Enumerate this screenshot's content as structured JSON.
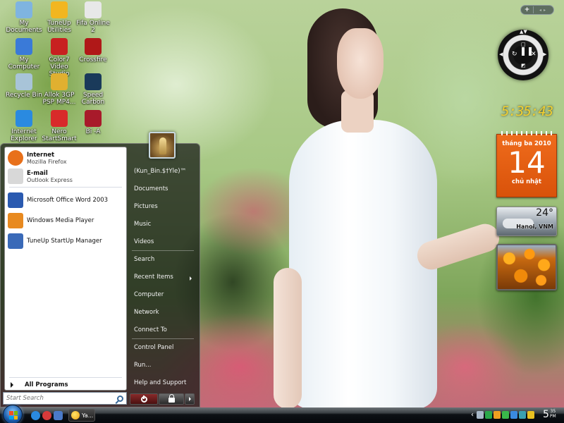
{
  "desktop": {
    "icons": [
      {
        "label_1": "My",
        "label_2": "Documents",
        "icon": "documents-icon",
        "color": "#7fb4e0"
      },
      {
        "label_1": "TuneUp",
        "label_2": "Utilities",
        "icon": "tuneup-icon",
        "color": "#f2b620"
      },
      {
        "label_1": "Fifa Online 2",
        "label_2": "",
        "icon": "fifa-icon",
        "color": "#e8e8e8"
      },
      {
        "label_1": "My",
        "label_2": "Computer",
        "icon": "computer-icon",
        "color": "#3a7ad8"
      },
      {
        "label_1": "Color7 Video",
        "label_2": "Studio",
        "icon": "video-studio-icon",
        "color": "#c82020"
      },
      {
        "label_1": "Crossfire",
        "label_2": "",
        "icon": "crossfire-icon",
        "color": "#b01818"
      },
      {
        "label_1": "Recycle Bin",
        "label_2": "",
        "icon": "recycle-bin-icon",
        "color": "#a8c4d8"
      },
      {
        "label_1": "Allok 3GP",
        "label_2": "PSP MP4...",
        "icon": "allok-icon",
        "color": "#e0b030"
      },
      {
        "label_1": "Speed",
        "label_2": "Carbon",
        "icon": "nfs-icon",
        "color": "#1a3a5a"
      },
      {
        "label_1": "Internet",
        "label_2": "Explorer",
        "icon": "ie-icon",
        "color": "#2a8ae0"
      },
      {
        "label_1": "Nero",
        "label_2": "StartSmart",
        "icon": "nero-icon",
        "color": "#d82a2a"
      },
      {
        "label_1": "Bi -A",
        "label_2": "",
        "icon": "bia-icon",
        "color": "#a81a2a"
      }
    ]
  },
  "start_menu": {
    "pinned": [
      {
        "title": "Internet",
        "subtitle": "Mozilla Firefox",
        "icon": "firefox-icon",
        "color": "#e8701a"
      },
      {
        "title": "E-mail",
        "subtitle": "Outlook Express",
        "icon": "mail-icon",
        "color": "#d8d8d8"
      }
    ],
    "recent": [
      {
        "label": "Microsoft Office Word 2003",
        "icon": "word-icon",
        "color": "#2a5ab0"
      },
      {
        "label": "Windows Media Player",
        "icon": "media-player-icon",
        "color": "#e88a20"
      },
      {
        "label": "TuneUp StartUp Manager",
        "icon": "startup-manager-icon",
        "color": "#3a6ab8"
      }
    ],
    "all_programs_label": "All Programs",
    "search_placeholder": "Start Search",
    "user_name": "(Kun_Bin.$†Yle)™",
    "right_links": [
      {
        "label": "Documents"
      },
      {
        "label": "Pictures"
      },
      {
        "label": "Music"
      },
      {
        "label": "Videos"
      },
      {
        "label": "Search"
      },
      {
        "label": "Recent Items",
        "has_submenu": true
      },
      {
        "label": "Computer"
      },
      {
        "label": "Network"
      },
      {
        "label": "Connect To"
      },
      {
        "label": "Control Panel"
      },
      {
        "label": "Run..."
      },
      {
        "label": "Help and Support"
      }
    ]
  },
  "taskbar": {
    "quick_launch": [
      {
        "icon": "ie-quicklaunch-icon",
        "color": "#2a8ae0"
      },
      {
        "icon": "nero-quicklaunch-icon",
        "color": "#d83a3a"
      },
      {
        "icon": "show-desktop-icon",
        "color": "#4a7ac8"
      }
    ],
    "task_label": "Ya...",
    "tray_icons": [
      {
        "icon": "device-icon",
        "color": "#a8b8c8"
      },
      {
        "icon": "network-icon",
        "color": "#2aa84a"
      },
      {
        "icon": "messenger-smile-icon",
        "color": "#f0a020"
      },
      {
        "icon": "green-status-icon",
        "color": "#3ab84a"
      },
      {
        "icon": "monitor-icon",
        "color": "#3a8ae0"
      },
      {
        "icon": "app-tray-icon",
        "color": "#3aa0b0"
      },
      {
        "icon": "yahoo-buddy-icon",
        "color": "#e8c020"
      }
    ],
    "clock_hour": "5",
    "clock_minute": "35",
    "clock_ampm": "PM"
  },
  "gadgets": {
    "sidebar_add": "+",
    "clock_time": "5:35:43",
    "calendar": {
      "month_year": "tháng ba 2010",
      "day": "14",
      "weekday": "chủ nhật"
    },
    "weather": {
      "temperature": "24°",
      "location": "Hanoi, VNM"
    },
    "accent_color": "#e8621a"
  }
}
